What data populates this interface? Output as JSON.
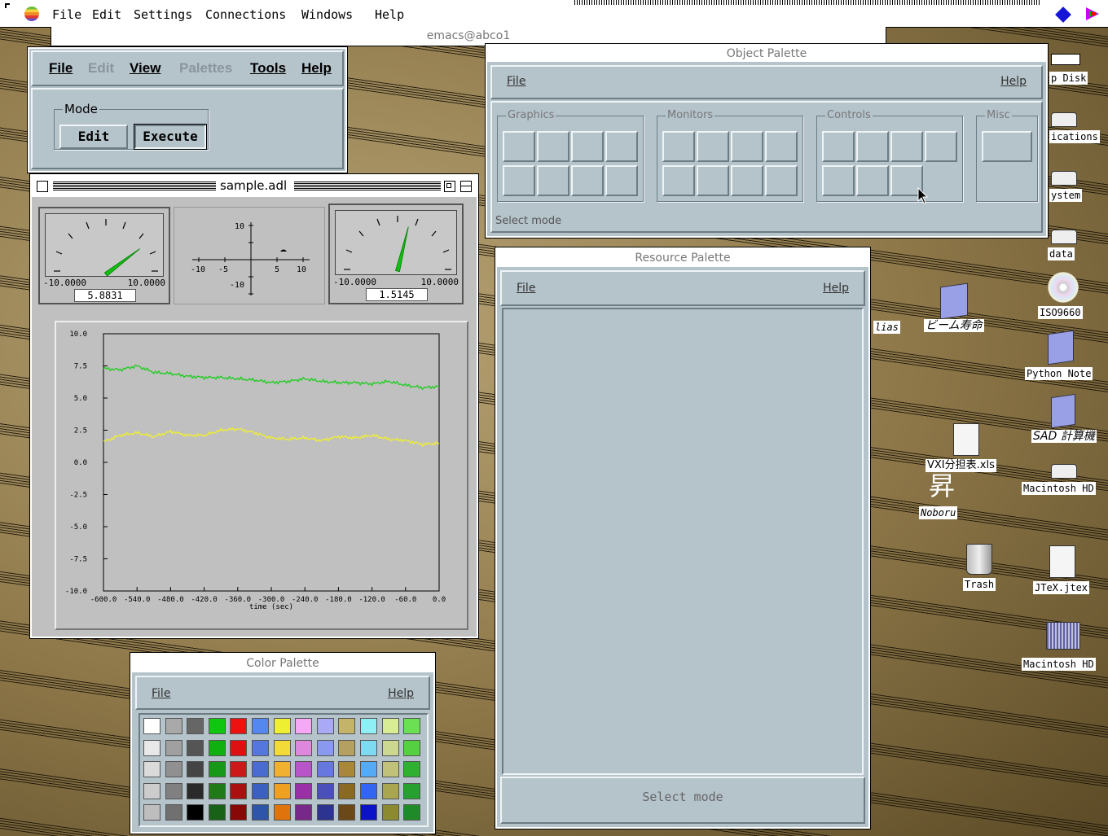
{
  "menubar": {
    "items": [
      "File",
      "Edit",
      "Settings",
      "Connections",
      "Windows",
      "Help"
    ]
  },
  "emacs": {
    "title": "emacs@abco1"
  },
  "main": {
    "menus": [
      "File",
      "Edit",
      "View",
      "Palettes",
      "Tools",
      "Help"
    ],
    "mode_label": "Mode",
    "edit_button": "Edit",
    "execute_button": "Execute"
  },
  "adl": {
    "title": "sample.adl",
    "meter1": {
      "min": "-10.0000",
      "max": "10.0000",
      "value": "5.8831",
      "fraction": 0.794
    },
    "meter2": {
      "min": "-10.0000",
      "max": "10.0000",
      "value": "1.5145",
      "fraction": 0.576
    },
    "cartesian": {
      "y_top": "10",
      "y_bottom": "-10",
      "x_ticks": [
        "-10",
        "-5",
        "5",
        "10"
      ]
    }
  },
  "object_palette": {
    "title": "Object Palette",
    "file": "File",
    "help": "Help",
    "groups": [
      "Graphics",
      "Monitors",
      "Controls",
      "Misc"
    ],
    "status": "Select mode"
  },
  "resource_palette": {
    "title": "Resource Palette",
    "file": "File",
    "help": "Help",
    "status": "Select mode"
  },
  "color_palette": {
    "title": "Color Palette",
    "file": "File",
    "help": "Help",
    "colors": [
      [
        "#ffffff",
        "#a9a9a9",
        "#666666",
        "#11c611",
        "#ee1111",
        "#5588ee",
        "#eeee33",
        "#f5a8f5",
        "#a9a9f5",
        "#c4b46a",
        "#8ef0f5",
        "#d8ec96",
        "#6ae052"
      ],
      [
        "#e8e8e8",
        "#a0a0a0",
        "#555555",
        "#10b010",
        "#dd1111",
        "#5577dd",
        "#f2da38",
        "#dd88dd",
        "#8899ee",
        "#b4a060",
        "#7ddaf0",
        "#ccd890",
        "#55d040"
      ],
      [
        "#dadada",
        "#909090",
        "#444444",
        "#189818",
        "#cc1818",
        "#4a6cd0",
        "#f0b030",
        "#b855c8",
        "#6677dd",
        "#a88838",
        "#55aaf5",
        "#c0c27a",
        "#30b030"
      ],
      [
        "#cccccc",
        "#808080",
        "#2a2a2a",
        "#207a18",
        "#aa1010",
        "#3c60c0",
        "#f0a020",
        "#9a30a8",
        "#4a50b8",
        "#8a6a20",
        "#3366f0",
        "#a8a650",
        "#28a030"
      ],
      [
        "#bebebe",
        "#707070",
        "#000000",
        "#176217",
        "#880808",
        "#2e55a8",
        "#e0740c",
        "#782888",
        "#2c3490",
        "#6a4818",
        "#0b12c8",
        "#8c8a30",
        "#1e8a28"
      ]
    ]
  },
  "chart_data": {
    "type": "line",
    "title": "",
    "xlabel": "time (sec)",
    "ylabel": "",
    "xlim": [
      -600,
      0
    ],
    "ylim": [
      -10,
      10
    ],
    "x_ticks": [
      "-600.0",
      "-540.0",
      "-480.0",
      "-420.0",
      "-360.0",
      "-300.0",
      "-240.0",
      "-180.0",
      "-120.0",
      "-60.0",
      "0.0"
    ],
    "y_ticks": [
      "10.0",
      "7.5",
      "5.0",
      "2.5",
      "0.0",
      "-2.5",
      "-5.0",
      "-7.5",
      "-10.0"
    ],
    "x": [
      -600,
      -570,
      -540,
      -510,
      -480,
      -450,
      -420,
      -390,
      -360,
      -330,
      -300,
      -270,
      -240,
      -210,
      -180,
      -150,
      -120,
      -90,
      -60,
      -30,
      0
    ],
    "series": [
      {
        "color": "#22cc22",
        "values": [
          7.3,
          7.2,
          7.5,
          7.0,
          6.9,
          6.7,
          6.6,
          6.6,
          6.5,
          6.4,
          6.2,
          6.3,
          6.5,
          6.3,
          6.2,
          6.2,
          6.1,
          6.3,
          6.0,
          5.8,
          5.9
        ]
      },
      {
        "color": "#eeee33",
        "values": [
          1.6,
          2.1,
          2.3,
          2.0,
          2.4,
          2.1,
          2.1,
          2.5,
          2.6,
          2.3,
          1.9,
          1.8,
          1.9,
          1.7,
          2.0,
          1.9,
          2.1,
          1.8,
          1.7,
          1.4,
          1.5
        ]
      }
    ]
  },
  "desktop": {
    "icons": [
      "p Disk",
      "ications",
      "ystem",
      "data",
      "ISO9660",
      "lias",
      "ビーム寿命",
      "Python Note",
      "SAD 計算機",
      "VXI分担表.xls",
      "Macintosh HD",
      "昇",
      "Noboru",
      "Trash",
      "JTeX.jtex",
      "Macintosh HD"
    ]
  }
}
